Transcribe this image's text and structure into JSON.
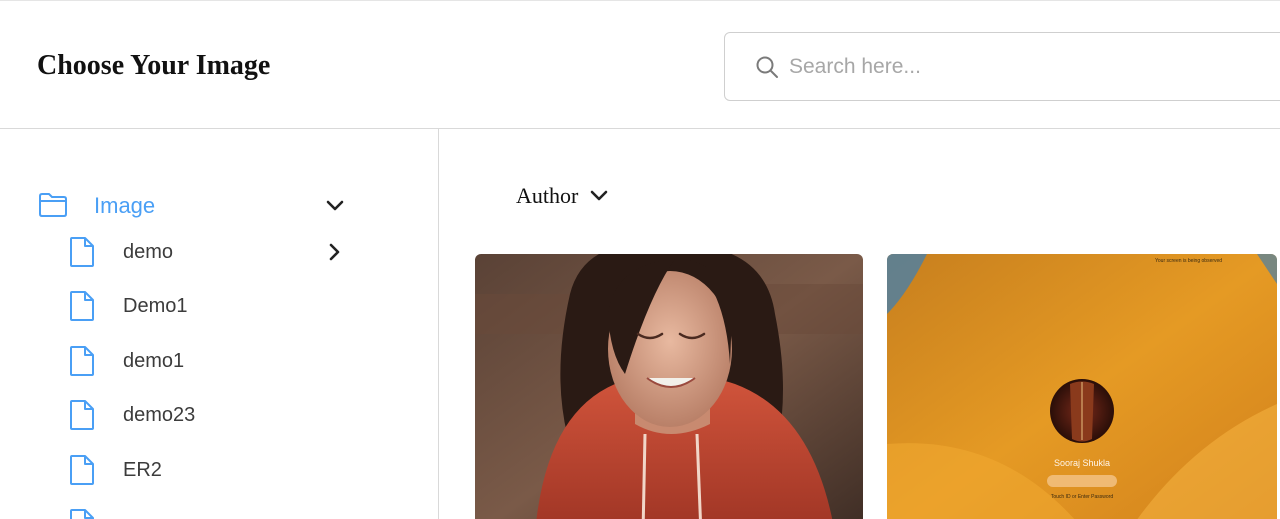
{
  "header": {
    "title": "Choose Your Image",
    "search_placeholder": "Search here..."
  },
  "sidebar": {
    "root": {
      "label": "Image",
      "icon": "folder-icon",
      "expanded": true
    },
    "items": [
      {
        "label": "demo",
        "icon": "file-icon",
        "has_children": true
      },
      {
        "label": "Demo1",
        "icon": "file-icon"
      },
      {
        "label": "demo1",
        "icon": "file-icon"
      },
      {
        "label": "demo23",
        "icon": "file-icon"
      },
      {
        "label": "ER2",
        "icon": "file-icon"
      }
    ]
  },
  "main": {
    "sort": {
      "label": "Author"
    },
    "cards": [
      {
        "kind": "portrait-photo"
      },
      {
        "kind": "lock-screen",
        "user_name": "Sooraj Shukla",
        "hint_text": "Touch ID or Enter Password",
        "banner_text": "Your screen is being observed"
      }
    ]
  },
  "colors": {
    "accent": "#4a9ff5",
    "border": "#d9d9d9",
    "text": "#3c3c3c",
    "placeholder": "#a7a7a7"
  }
}
